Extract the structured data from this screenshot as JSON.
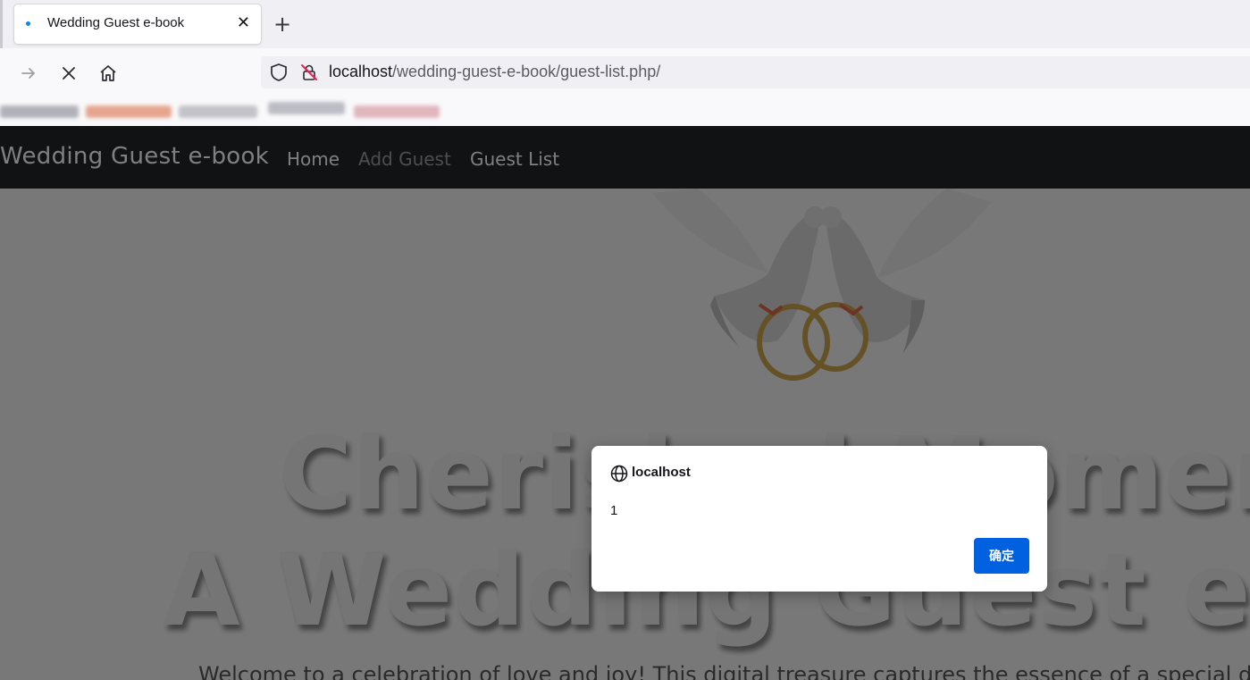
{
  "browser": {
    "tab": {
      "title": "Wedding Guest e-book",
      "close_glyph": "✕"
    },
    "new_tab_glyph": "+",
    "url": {
      "host": "localhost",
      "path": "/wedding-guest-e-book/guest-list.php/"
    },
    "icons": [
      "forward-arrow-icon",
      "stop-loading-icon",
      "home-icon",
      "tracking-shield-icon",
      "insecure-lock-icon"
    ]
  },
  "site": {
    "brand": "Wedding Guest e-book",
    "nav": [
      {
        "label": "Home",
        "color": "#ffffff"
      },
      {
        "label": "Add Guest",
        "color": "#9a9da1"
      },
      {
        "label": "Guest List",
        "color": "#ffffff"
      }
    ],
    "hero": {
      "line1": "Cherished Moments",
      "line2": "A Wedding Guest e-Book",
      "subtitle": "Welcome to a celebration of love and joy! This digital treasure captures the essence of a special day"
    }
  },
  "dialog": {
    "origin": "localhost",
    "message": "1",
    "ok_label": "确定",
    "accent": "#0061e0"
  }
}
